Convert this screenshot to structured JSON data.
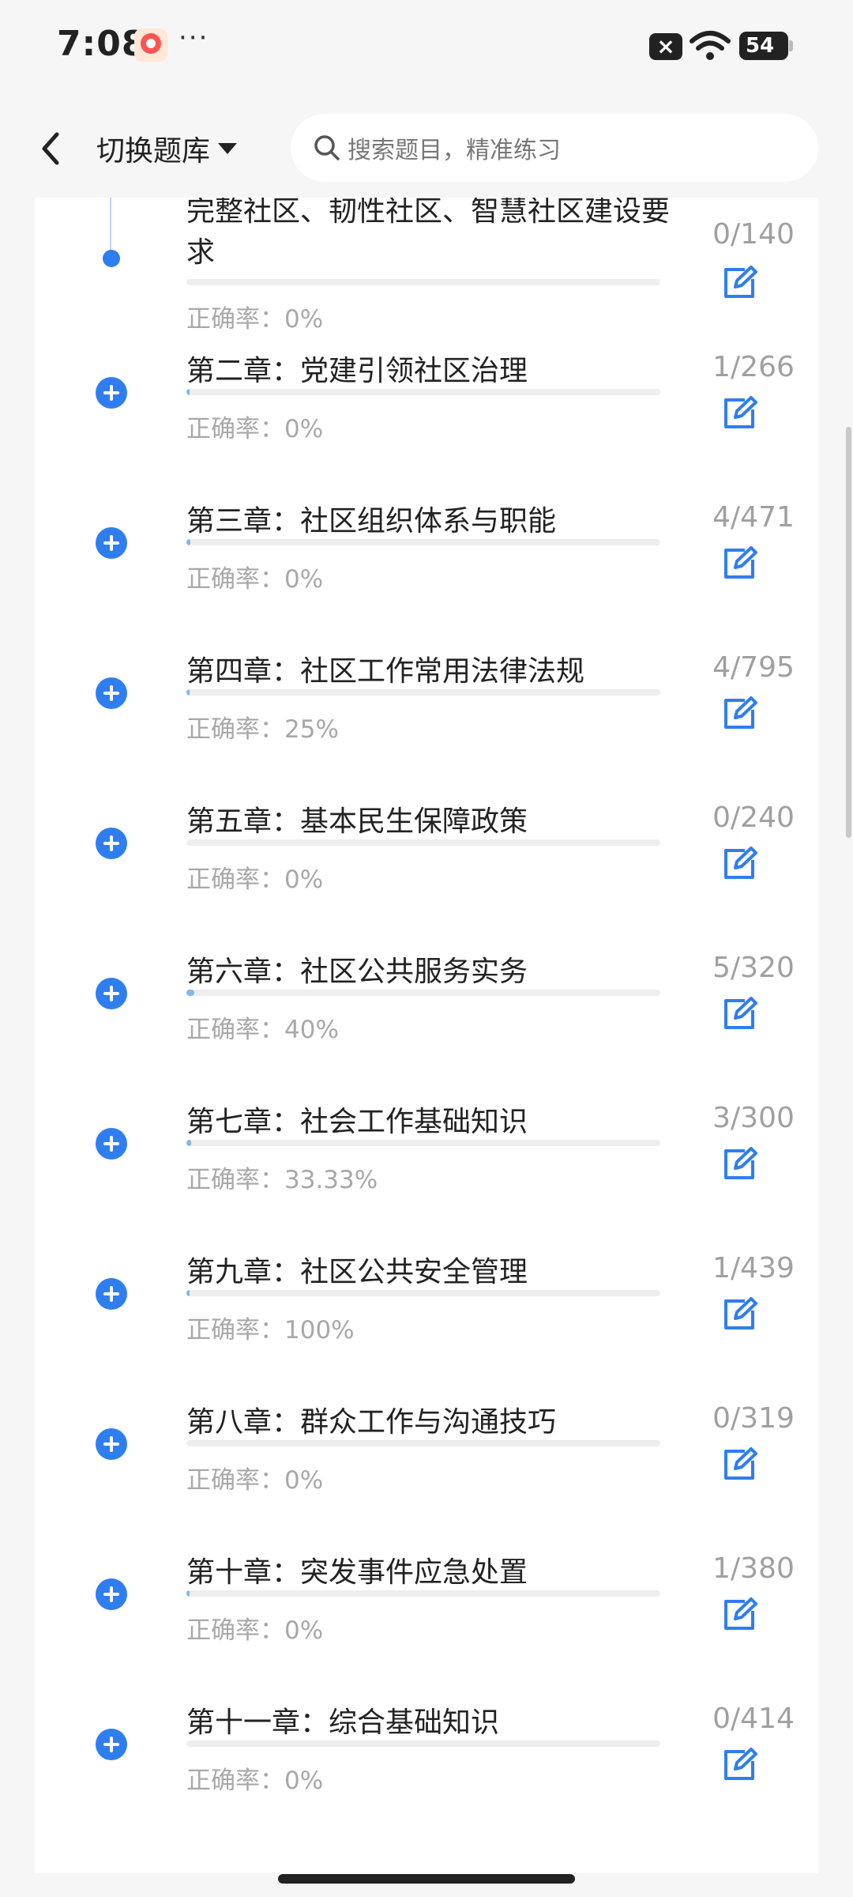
{
  "status_bar": {
    "time": "7:08",
    "dots": "···",
    "battery": "54"
  },
  "header": {
    "bank_switch_label": "切换题库",
    "search_placeholder": "搜索题目，精准练习"
  },
  "first_item": {
    "title": "完整社区、韧性社区、智慧社区建设要求",
    "count": "0/140",
    "accuracy": "正确率：0%",
    "progress": 0
  },
  "chapters": [
    {
      "title": "第二章：党建引领社区治理",
      "count": "1/266",
      "accuracy": "正确率：0%",
      "progress": 0.004
    },
    {
      "title": "第三章：社区组织体系与职能",
      "count": "4/471",
      "accuracy": "正确率：0%",
      "progress": 0.008
    },
    {
      "title": "第四章：社区工作常用法律法规",
      "count": "4/795",
      "accuracy": "正确率：25%",
      "progress": 0.005
    },
    {
      "title": "第五章：基本民生保障政策",
      "count": "0/240",
      "accuracy": "正确率：0%",
      "progress": 0
    },
    {
      "title": "第六章：社区公共服务实务",
      "count": "5/320",
      "accuracy": "正确率：40%",
      "progress": 0.016
    },
    {
      "title": "第七章：社会工作基础知识",
      "count": "3/300",
      "accuracy": "正确率：33.33%",
      "progress": 0.01
    },
    {
      "title": "第九章：社区公共安全管理",
      "count": "1/439",
      "accuracy": "正确率：100%",
      "progress": 0.002
    },
    {
      "title": "第八章：群众工作与沟通技巧",
      "count": "0/319",
      "accuracy": "正确率：0%",
      "progress": 0
    },
    {
      "title": "第十章：突发事件应急处置",
      "count": "1/380",
      "accuracy": "正确率：0%",
      "progress": 0.003
    },
    {
      "title": "第十一章：综合基础知识",
      "count": "0/414",
      "accuracy": "正确率：0%",
      "progress": 0
    }
  ],
  "colors": {
    "accent": "#2f7ef0",
    "progress_fill": "#7fb7f0",
    "muted_text": "#a8a8a8"
  },
  "icons": {
    "back": "chevron-left-icon",
    "caret": "caret-down-icon",
    "search": "search-icon",
    "expand": "plus-circle-icon",
    "practice": "edit-icon"
  }
}
